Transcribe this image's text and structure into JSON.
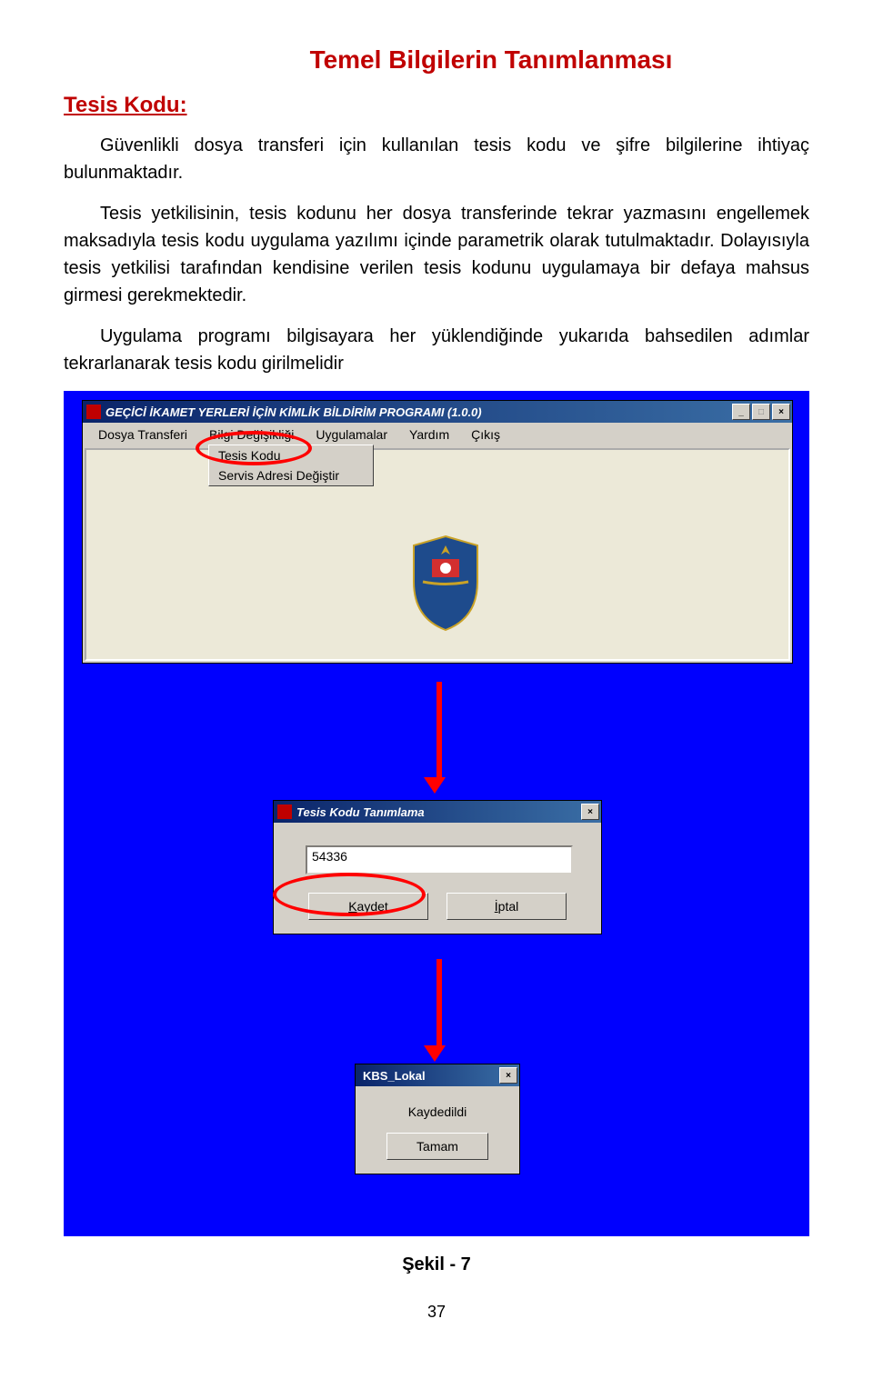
{
  "header": {
    "title": "Temel Bilgilerin Tanımlanması"
  },
  "section": {
    "label": "Tesis Kodu:"
  },
  "paragraphs": {
    "p1": "Güvenlikli dosya transferi için kullanılan tesis kodu ve şifre bilgilerine ihtiyaç bulunmaktadır.",
    "p2": "Tesis yetkilisinin, tesis kodunu her dosya transferinde tekrar yazmasını engellemek maksadıyla tesis kodu uygulama yazılımı içinde parametrik olarak tutulmaktadır. Dolayısıyla tesis yetkilisi tarafından kendisine verilen tesis kodunu uygulamaya bir defaya mahsus girmesi gerekmektedir.",
    "p3": "Uygulama programı bilgisayara her yüklendiğinde yukarıda bahsedilen adımlar tekrarlanarak tesis kodu girilmelidir"
  },
  "app_window": {
    "title": "GEÇİCİ İKAMET YERLERİ İÇİN KİMLİK BİLDİRİM PROGRAMI (1.0.0)",
    "menu": {
      "m1": "Dosya Transferi",
      "m2": "Bilgi Değişikliği",
      "m3": "Uygulamalar",
      "m4": "Yardım",
      "m5": "Çıkış"
    },
    "dropdown": {
      "d1": "Tesis Kodu",
      "d2": "Servis Adresi Değiştir"
    }
  },
  "dialog_tesis": {
    "title": "Tesis Kodu Tanımlama",
    "value": "54336",
    "btn_save_u": "K",
    "btn_save_rest": "aydet",
    "btn_cancel_u": "İ",
    "btn_cancel_rest": "ptal"
  },
  "dialog_msg": {
    "title": "KBS_Lokal",
    "message": "Kaydedildi",
    "btn_ok": "Tamam"
  },
  "figure": {
    "caption": "Şekil - 7"
  },
  "page_number": "37"
}
